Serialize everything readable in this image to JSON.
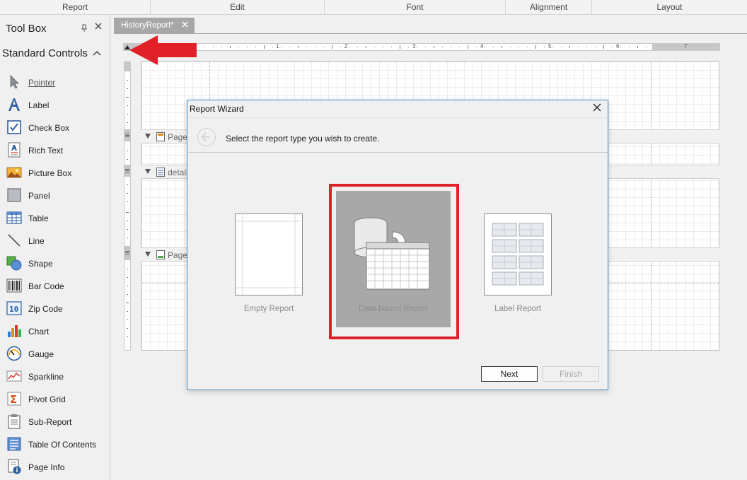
{
  "ribbon": {
    "groups": [
      "Report",
      "Edit",
      "Font",
      "Alignment",
      "Layout"
    ]
  },
  "toolbox": {
    "title": "Tool Box",
    "section_title": "Standard Controls",
    "items": [
      {
        "label": "Pointer",
        "icon": "pointer-icon"
      },
      {
        "label": "Label",
        "icon": "label-icon"
      },
      {
        "label": "Check Box",
        "icon": "checkbox-icon"
      },
      {
        "label": "Rich Text",
        "icon": "rich-text-icon"
      },
      {
        "label": "Picture Box",
        "icon": "picture-box-icon"
      },
      {
        "label": "Panel",
        "icon": "panel-icon"
      },
      {
        "label": "Table",
        "icon": "table-icon"
      },
      {
        "label": "Line",
        "icon": "line-icon"
      },
      {
        "label": "Shape",
        "icon": "shape-icon"
      },
      {
        "label": "Bar Code",
        "icon": "barcode-icon"
      },
      {
        "label": "Zip Code",
        "icon": "zip-code-icon"
      },
      {
        "label": "Chart",
        "icon": "chart-icon"
      },
      {
        "label": "Gauge",
        "icon": "gauge-icon"
      },
      {
        "label": "Sparkline",
        "icon": "sparkline-icon"
      },
      {
        "label": "Pivot Grid",
        "icon": "pivot-grid-icon"
      },
      {
        "label": "Sub-Report",
        "icon": "sub-report-icon"
      },
      {
        "label": "Table Of Contents",
        "icon": "table-of-contents-icon"
      },
      {
        "label": "Page Info",
        "icon": "page-info-icon"
      }
    ]
  },
  "document": {
    "tab_label": "HistoryReport*",
    "ruler_numbers": [
      "1",
      "2",
      "3",
      "4",
      "5",
      "6",
      "7"
    ],
    "bands": [
      {
        "label": "Page",
        "icon": "page-header-band-icon"
      },
      {
        "label": "detail",
        "icon": "detail-band-icon"
      },
      {
        "label": "Page",
        "icon": "page-footer-band-icon"
      }
    ]
  },
  "wizard": {
    "title": "Report Wizard",
    "prompt": "Select the report type you wish to create.",
    "options": [
      {
        "label": "Empty Report"
      },
      {
        "label": "Data-bound Report"
      },
      {
        "label": "Label Report"
      }
    ],
    "next_label": "Next",
    "finish_label": "Finish"
  },
  "colors": {
    "highlight": "#e0212a",
    "selected_bg": "#a8a8a8",
    "dialog_border": "#4a90c8"
  }
}
